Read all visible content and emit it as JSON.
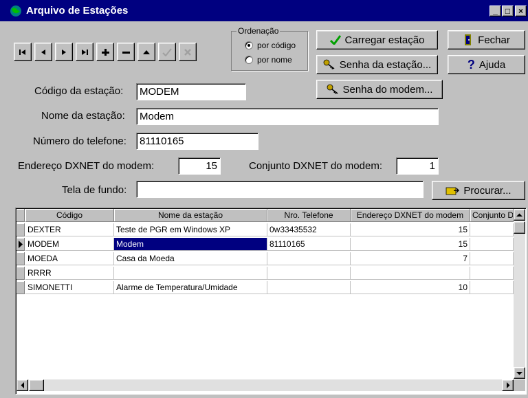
{
  "window": {
    "title": "Arquivo de Estações",
    "controls": [
      "minimize",
      "maximize",
      "close"
    ]
  },
  "navigator": {
    "buttons": [
      {
        "name": "first-record-button",
        "icon": "first-icon"
      },
      {
        "name": "prior-record-button",
        "icon": "prior-icon"
      },
      {
        "name": "next-record-button",
        "icon": "next-icon"
      },
      {
        "name": "last-record-button",
        "icon": "last-icon"
      },
      {
        "name": "insert-record-button",
        "icon": "plus-icon"
      },
      {
        "name": "delete-record-button",
        "icon": "minus-icon"
      },
      {
        "name": "edit-record-button",
        "icon": "up-arrow-icon"
      },
      {
        "name": "post-record-button",
        "icon": "check-icon",
        "disabled": true
      },
      {
        "name": "cancel-record-button",
        "icon": "x-icon",
        "disabled": true
      }
    ]
  },
  "ordenacao": {
    "title": "Ordenação",
    "options": [
      {
        "label": "por código",
        "selected": true
      },
      {
        "label": "por nome",
        "selected": false
      }
    ]
  },
  "buttons": {
    "carregar": "Carregar estação",
    "fechar": "Fechar",
    "senha_estacao": "Senha da estação...",
    "ajuda": "Ajuda",
    "senha_modem": "Senha do modem...",
    "procurar": "Procurar..."
  },
  "form": {
    "codigo_label": "Código da estação:",
    "codigo_value": "MODEM",
    "nome_label": "Nome da estação:",
    "nome_value": "Modem",
    "telefone_label": "Número do telefone:",
    "telefone_value": "81110165",
    "endereco_label": "Endereço DXNET do modem:",
    "endereco_value": "15",
    "conjunto_label": "Conjunto DXNET do modem:",
    "conjunto_value": "1",
    "tela_label": "Tela de fundo:",
    "tela_value": ""
  },
  "grid": {
    "columns": [
      "Código",
      "Nome da estação",
      "Nro. Telefone",
      "Endereço DXNET do modem",
      "Conjunto D"
    ],
    "rows": [
      {
        "codigo": "DEXTER",
        "nome": "Teste de PGR em Windows XP",
        "telefone": "0w33435532",
        "endereco": "15",
        "conjunto": "",
        "current": false
      },
      {
        "codigo": "MODEM",
        "nome": "Modem",
        "telefone": "81110165",
        "endereco": "15",
        "conjunto": "",
        "current": true
      },
      {
        "codigo": "MOEDA",
        "nome": "Casa da Moeda",
        "telefone": "",
        "endereco": "7",
        "conjunto": "",
        "current": false
      },
      {
        "codigo": "RRRR",
        "nome": "",
        "telefone": "",
        "endereco": "",
        "conjunto": "",
        "current": false
      },
      {
        "codigo": "SIMONETTI",
        "nome": "Alarme de Temperatura/Umidade",
        "telefone": "",
        "endereco": "10",
        "conjunto": "",
        "current": false
      }
    ]
  },
  "colors": {
    "titlebar": "#000080",
    "face": "#c0c0c0",
    "selection": "#000080",
    "check_green": "#00a000"
  }
}
